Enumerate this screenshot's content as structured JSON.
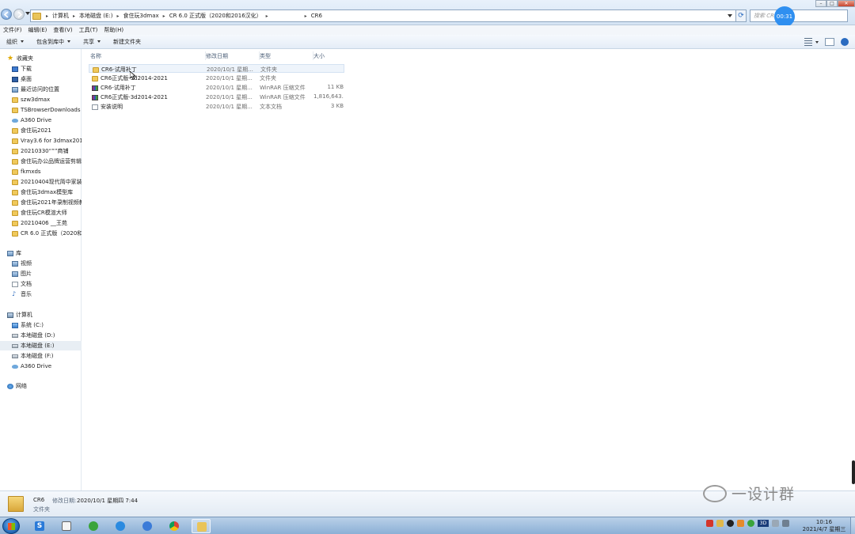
{
  "address": {
    "crumbs": [
      "计算机",
      "本地磁盘 (E:)",
      "食住玩3dmax",
      "CR 6.0 正式版（2020和2016汉化）",
      "",
      "CR6"
    ],
    "search_placeholder": "搜索 CR6",
    "timer": "00:31"
  },
  "menu": [
    "文件(F)",
    "编辑(E)",
    "查看(V)",
    "工具(T)",
    "帮助(H)"
  ],
  "toolbar": {
    "organize": "组织",
    "include": "包含到库中",
    "share": "共享",
    "new_folder": "新建文件夹"
  },
  "sidebar": {
    "favorites_label": "收藏夹",
    "favorites": [
      "下载",
      "桌面",
      "最近访问的位置",
      "szw3dmax",
      "TSBrowserDownloads",
      "A360 Drive",
      "食住玩2021",
      "Vray3.6 for 3dmax2016",
      "20210330“””商铺",
      "食住玩办公品牌运营剪辑",
      "fkmxds",
      "20210404现代简中家装[",
      "食住玩3dmax模型库",
      "食住玩2021年录制视频教",
      "食住玩CR模渲大师",
      "20210406 __王苑",
      "CR 6.0 正式版（2020和2"
    ],
    "library_label": "库",
    "library": [
      "视频",
      "图片",
      "文档",
      "音乐"
    ],
    "computer_label": "计算机",
    "computer": [
      "系统 (C:)",
      "本地磁盘 (D:)",
      "本地磁盘 (E:)",
      "本地磁盘 (F:)",
      "A360 Drive"
    ],
    "network_label": "网络"
  },
  "columns": {
    "name": "名称",
    "date": "修改日期",
    "type": "类型",
    "size": "大小"
  },
  "files": [
    {
      "name": "CR6-试用补丁",
      "date": "2020/10/1 星期...",
      "type": "文件夹",
      "size": "",
      "icon": "folder-icon"
    },
    {
      "name": "CR6正式版-3d2014-2021",
      "date": "2020/10/1 星期...",
      "type": "文件夹",
      "size": "",
      "icon": "folder-icon"
    },
    {
      "name": "CR6-试用补丁",
      "date": "2020/10/1 星期...",
      "type": "WinRAR 压缩文件",
      "size": "11 KB",
      "icon": "rar-archive-icon"
    },
    {
      "name": "CR6正式版-3d2014-2021",
      "date": "2020/10/1 星期...",
      "type": "WinRAR 压缩文件",
      "size": "1,816,643...",
      "icon": "rar-archive-icon"
    },
    {
      "name": "安装说明",
      "date": "2020/10/1 星期...",
      "type": "文本文档",
      "size": "3 KB",
      "icon": "text-document-icon"
    }
  ],
  "details": {
    "name": "CR6",
    "date_label": "修改日期:",
    "date": "2020/10/1 星期四 7:44",
    "type": "文件夹"
  },
  "watermark": "一设计群",
  "clock": {
    "time": "10:16",
    "date": "2021/4/7 星期三"
  },
  "tray_3d_label": "3D",
  "colors": {
    "accent": "#2f8ff0",
    "folder": "#f0c95b",
    "selection": "#eef4fb"
  }
}
